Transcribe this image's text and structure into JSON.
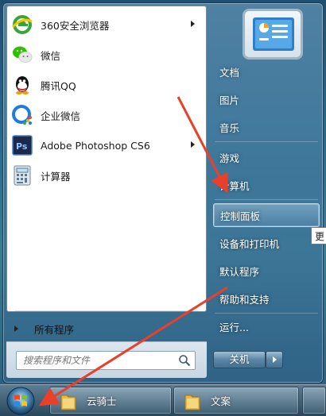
{
  "programs": [
    {
      "label": "360安全浏览器",
      "icon": "360-browser-icon",
      "has_submenu": true
    },
    {
      "label": "微信",
      "icon": "wechat-icon",
      "has_submenu": false
    },
    {
      "label": "腾讯QQ",
      "icon": "qq-icon",
      "has_submenu": false
    },
    {
      "label": "企业微信",
      "icon": "wecom-icon",
      "has_submenu": false
    },
    {
      "label": "Adobe Photoshop CS6",
      "icon": "photoshop-icon",
      "has_submenu": true
    },
    {
      "label": "计算器",
      "icon": "calculator-icon",
      "has_submenu": false
    }
  ],
  "all_programs_label": "所有程序",
  "search": {
    "placeholder": "搜索程序和文件"
  },
  "right_menu": [
    {
      "label": "文档"
    },
    {
      "label": "图片"
    },
    {
      "label": "音乐"
    },
    {
      "label": "游戏"
    },
    {
      "label": "计算机"
    },
    {
      "label": "控制面板"
    },
    {
      "label": "设备和打印机"
    },
    {
      "label": "默认程序"
    },
    {
      "label": "帮助和支持"
    },
    {
      "label": "运行..."
    }
  ],
  "hovered_item": "控制面板",
  "tooltip_text": "更",
  "shutdown_label": "关机",
  "taskbar": {
    "buttons": [
      {
        "label": "云骑士"
      },
      {
        "label": "文案"
      }
    ]
  },
  "colors": {
    "annotation_arrow": "#e8402a",
    "left_pane_bg": "#ffffff",
    "menu_glass": "#4a7fa3"
  }
}
